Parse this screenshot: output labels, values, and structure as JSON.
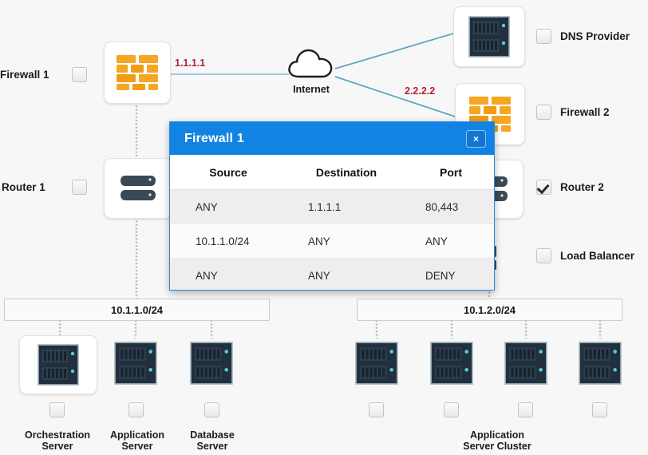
{
  "diagram": {
    "background_color": "#f7f7f7",
    "link_color": "#8fc2de",
    "dotted_color": "#b6b6b6",
    "ip_label_color": "#b0213a",
    "accent_color": "#1283e2"
  },
  "nodes": {
    "firewall1": {
      "label": "Firewall 1",
      "icon": "firewall-icon",
      "checked": false
    },
    "internet": {
      "label": "Internet",
      "icon": "cloud-icon"
    },
    "dns_provider": {
      "label": "DNS Provider",
      "icon": "server-icon",
      "checked": false
    },
    "firewall2": {
      "label": "Firewall 2",
      "icon": "firewall-icon",
      "checked": false
    },
    "router1": {
      "label": "Router 1",
      "icon": "router-icon",
      "checked": false
    },
    "router2": {
      "label": "Router 2",
      "icon": "router-icon",
      "checked": true
    },
    "load_balancer": {
      "label": "Load Balancer",
      "icon": "load-balancer-icon",
      "checked": false
    }
  },
  "ip_labels": {
    "wan1": "1.1.1.1",
    "wan2": "2.2.2.2"
  },
  "subnets": [
    {
      "label": "10.1.1.0/24"
    },
    {
      "label": "10.1.2.0/24"
    }
  ],
  "left_servers": [
    {
      "label_line1": "Orchestration",
      "label_line2": "Server",
      "icon": "server-icon",
      "checked": false,
      "framed": true
    },
    {
      "label_line1": "Application",
      "label_line2": "Server",
      "icon": "server-icon",
      "checked": false,
      "framed": false
    },
    {
      "label_line1": "Database",
      "label_line2": "Server",
      "icon": "server-icon",
      "checked": false,
      "framed": false
    }
  ],
  "right_cluster": {
    "label_line1": "Application",
    "label_line2": "Server Cluster",
    "servers": [
      {
        "icon": "server-icon",
        "checked": false
      },
      {
        "icon": "server-icon",
        "checked": false
      },
      {
        "icon": "server-icon",
        "checked": false
      },
      {
        "icon": "server-icon",
        "checked": false
      }
    ]
  },
  "modal": {
    "title": "Firewall 1",
    "close_label": "×",
    "close_icon": "close-icon",
    "columns": [
      "Source",
      "Destination",
      "Port"
    ],
    "rows": [
      {
        "source": "ANY",
        "destination": "1.1.1.1",
        "port": "80,443"
      },
      {
        "source": "10.1.1.0/24",
        "destination": "ANY",
        "port": "ANY"
      },
      {
        "source": "ANY",
        "destination": "ANY",
        "port": "DENY"
      }
    ]
  }
}
